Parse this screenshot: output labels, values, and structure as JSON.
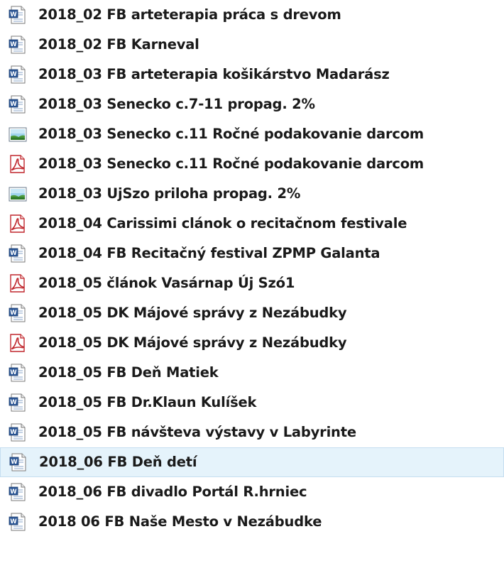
{
  "files": [
    {
      "name": "2018_02 FB arteterapia práca s drevom",
      "type": "word-document-icon"
    },
    {
      "name": "2018_02 FB Karneval",
      "type": "word-document-icon"
    },
    {
      "name": "2018_03 FB arteterapia košikárstvo Madarász",
      "type": "word-document-icon"
    },
    {
      "name": "2018_03 Senecko c.7-11 propag. 2%",
      "type": "word-document-icon"
    },
    {
      "name": "2018_03 Senecko c.11 Ročné podakovanie darcom",
      "type": "image-file-icon"
    },
    {
      "name": "2018_03 Senecko c.11 Ročné podakovanie darcom",
      "type": "pdf-file-icon"
    },
    {
      "name": "2018_03 UjSzo priloha propag. 2%",
      "type": "image-file-icon"
    },
    {
      "name": "2018_04 Carissimi clánok o recitačnom festivale",
      "type": "pdf-file-icon"
    },
    {
      "name": "2018_04 FB Recitačný festival ZPMP Galanta",
      "type": "word-document-icon"
    },
    {
      "name": "2018_05 článok Vasárnap Új Szó1",
      "type": "pdf-file-icon"
    },
    {
      "name": "2018_05 DK Májové správy z Nezábudky",
      "type": "word-document-icon"
    },
    {
      "name": "2018_05 DK Májové správy z Nezábudky",
      "type": "pdf-file-icon"
    },
    {
      "name": "2018_05 FB Deň Matiek",
      "type": "word-document-icon"
    },
    {
      "name": "2018_05 FB Dr.Klaun Kulíšek",
      "type": "word-document-icon"
    },
    {
      "name": "2018_05 FB návšteva výstavy v Labyrinte",
      "type": "word-document-icon"
    },
    {
      "name": "2018_06 FB Deň detí",
      "type": "word-document-icon",
      "selected": true
    },
    {
      "name": "2018_06 FB divadlo Portál R.hrniec",
      "type": "word-document-icon"
    },
    {
      "name": "2018 06 FB Naše Mesto v Nezábudke",
      "type": "word-document-icon"
    }
  ],
  "colors": {
    "selection_background": "#e5f3fb",
    "selection_border": "#c5def0",
    "word_blue": "#2b5797",
    "pdf_red": "#c0272d",
    "text": "#1a1a1a"
  }
}
